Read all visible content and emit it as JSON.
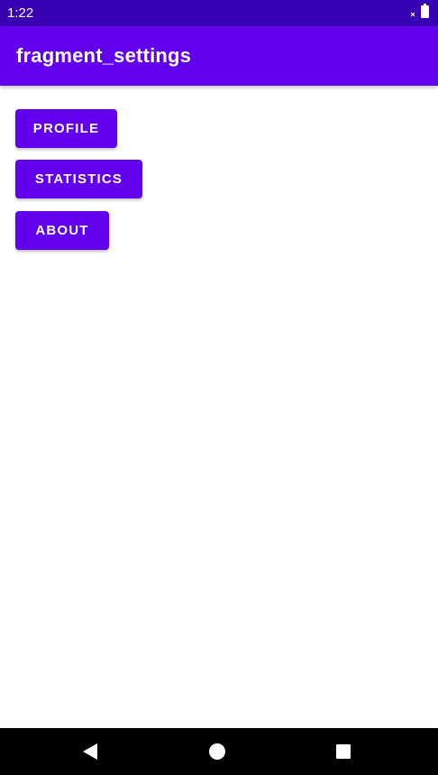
{
  "status_bar": {
    "time": "1:22",
    "background": "#3700B3",
    "icons": [
      "signal-off-icon",
      "battery-icon"
    ]
  },
  "app_bar": {
    "title": "fragment_settings",
    "background": "#6200EE"
  },
  "buttons": {
    "profile": "PROFILE",
    "statistics": "STATISTICS",
    "about": "ABOUT",
    "color": "#6200EE"
  },
  "nav_bar": {
    "icons": [
      "back-icon",
      "home-icon",
      "recents-icon"
    ]
  }
}
